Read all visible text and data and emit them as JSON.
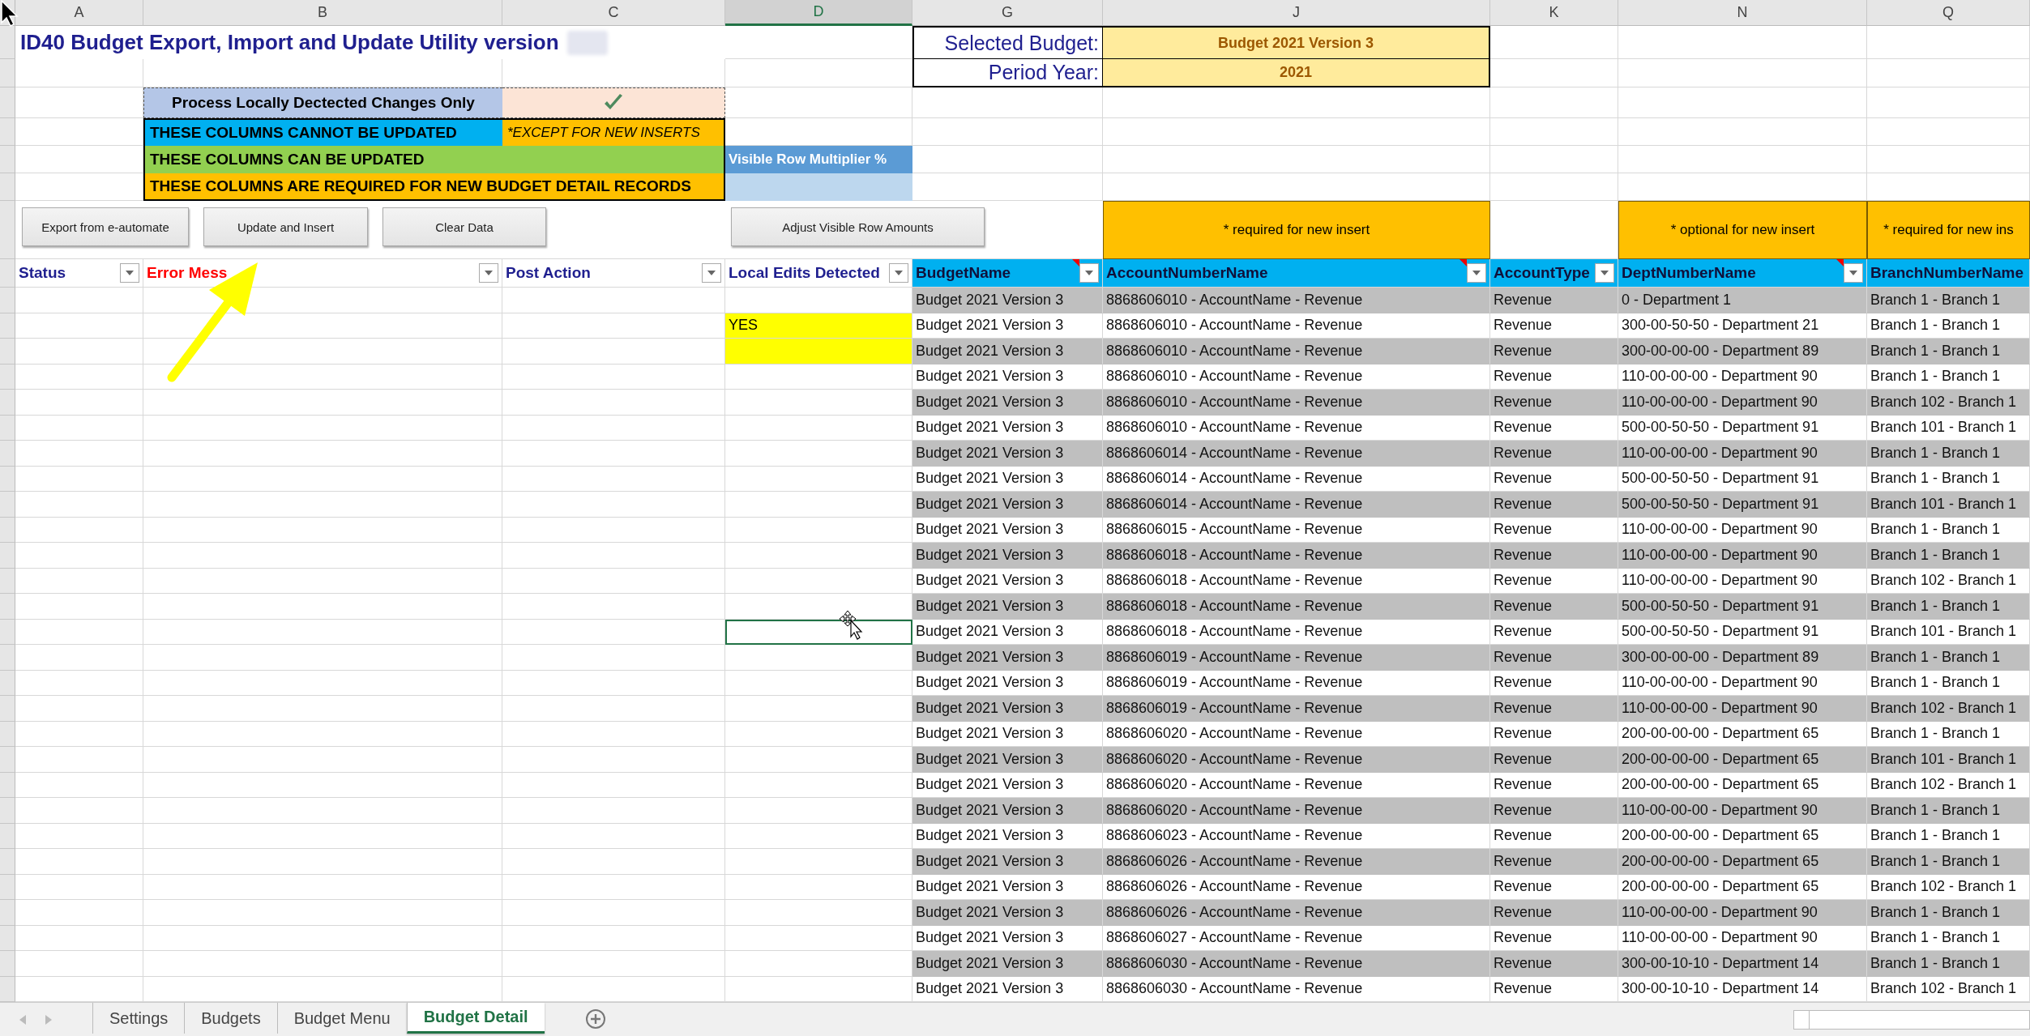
{
  "column_headers": [
    {
      "label": "A",
      "selected": false
    },
    {
      "label": "B",
      "selected": false
    },
    {
      "label": "C",
      "selected": false
    },
    {
      "label": "D",
      "selected": true
    },
    {
      "label": "G",
      "selected": false
    },
    {
      "label": "J",
      "selected": false
    },
    {
      "label": "K",
      "selected": false
    },
    {
      "label": "N",
      "selected": false
    },
    {
      "label": "Q",
      "selected": false
    }
  ],
  "title": "ID40 Budget Export, Import and Update Utility version",
  "selected_budget": {
    "label": "Selected Budget:",
    "value": "Budget 2021 Version 3"
  },
  "period_year": {
    "label": "Period Year:",
    "value": "2021"
  },
  "process_option": {
    "label": "Process Locally Dectected Changes Only",
    "checked": true
  },
  "legend": {
    "cannot_update": "THESE COLUMNS CANNOT BE UPDATED",
    "except_note": "*EXCEPT FOR NEW INSERTS",
    "can_update": "THESE COLUMNS CAN BE UPDATED",
    "required": "THESE COLUMNS ARE REQUIRED FOR NEW BUDGET DETAIL RECORDS"
  },
  "multiplier": {
    "label": "Visible Row Multiplier %"
  },
  "buttons": [
    "Export from e-automate",
    "Update and Insert",
    "Clear Data",
    "Adjust Visible Row Amounts"
  ],
  "column_notes": [
    "* required for new insert",
    "* optional for new insert",
    "* required for new ins"
  ],
  "status_columns": [
    {
      "label": "Status",
      "kind": "plain"
    },
    {
      "label": "Error Mess",
      "kind": "error"
    },
    {
      "label": "Post Action",
      "kind": "plain"
    },
    {
      "label": "Local Edits Detected",
      "kind": "plain"
    }
  ],
  "data_columns": [
    {
      "label": "BudgetName",
      "comment": true
    },
    {
      "label": "AccountNumberName",
      "comment": true
    },
    {
      "label": "AccountType",
      "comment": false
    },
    {
      "label": "DeptNumberName",
      "comment": true
    },
    {
      "label": "BranchNumberName",
      "comment": false
    }
  ],
  "rows": [
    {
      "cells": [
        "Budget 2021 Version 3",
        "8868606010 - AccountName - Revenue",
        "Revenue",
        "0 - Department 1",
        "Branch 1 - Branch 1"
      ],
      "highlighted": false,
      "selected": false
    },
    {
      "local_edits": "YES",
      "cells": [
        "Budget 2021 Version 3",
        "8868606010 - AccountName - Revenue",
        "Revenue",
        "300-00-50-50 - Department 21",
        "Branch 1 - Branch 1"
      ],
      "highlighted": true,
      "selected": false
    },
    {
      "cells": [
        "Budget 2021 Version 3",
        "8868606010 - AccountName - Revenue",
        "Revenue",
        "300-00-00-00 - Department 89",
        "Branch 1 - Branch 1"
      ],
      "highlighted": true,
      "selected": false
    },
    {
      "cells": [
        "Budget 2021 Version 3",
        "8868606010 - AccountName - Revenue",
        "Revenue",
        "110-00-00-00 - Department 90",
        "Branch 1 - Branch 1"
      ],
      "highlighted": false,
      "selected": false
    },
    {
      "cells": [
        "Budget 2021 Version 3",
        "8868606010 - AccountName - Revenue",
        "Revenue",
        "110-00-00-00 - Department 90",
        "Branch 102 - Branch 1"
      ],
      "highlighted": false,
      "selected": false
    },
    {
      "cells": [
        "Budget 2021 Version 3",
        "8868606010 - AccountName - Revenue",
        "Revenue",
        "500-00-50-50 - Department 91",
        "Branch 101 - Branch 1"
      ],
      "highlighted": false,
      "selected": false
    },
    {
      "cells": [
        "Budget 2021 Version 3",
        "8868606014 - AccountName - Revenue",
        "Revenue",
        "110-00-00-00 - Department 90",
        "Branch 1 - Branch 1"
      ],
      "highlighted": false,
      "selected": false
    },
    {
      "cells": [
        "Budget 2021 Version 3",
        "8868606014 - AccountName - Revenue",
        "Revenue",
        "500-00-50-50 - Department 91",
        "Branch 1 - Branch 1"
      ],
      "highlighted": false,
      "selected": false
    },
    {
      "cells": [
        "Budget 2021 Version 3",
        "8868606014 - AccountName - Revenue",
        "Revenue",
        "500-00-50-50 - Department 91",
        "Branch 101 - Branch 1"
      ],
      "highlighted": false,
      "selected": false
    },
    {
      "cells": [
        "Budget 2021 Version 3",
        "8868606015 - AccountName - Revenue",
        "Revenue",
        "110-00-00-00 - Department 90",
        "Branch 1 - Branch 1"
      ],
      "highlighted": false,
      "selected": false
    },
    {
      "cells": [
        "Budget 2021 Version 3",
        "8868606018 - AccountName - Revenue",
        "Revenue",
        "110-00-00-00 - Department 90",
        "Branch 1 - Branch 1"
      ],
      "highlighted": false,
      "selected": false
    },
    {
      "cells": [
        "Budget 2021 Version 3",
        "8868606018 - AccountName - Revenue",
        "Revenue",
        "110-00-00-00 - Department 90",
        "Branch 102 - Branch 1"
      ],
      "highlighted": false,
      "selected": false
    },
    {
      "cells": [
        "Budget 2021 Version 3",
        "8868606018 - AccountName - Revenue",
        "Revenue",
        "500-00-50-50 - Department 91",
        "Branch 1 - Branch 1"
      ],
      "highlighted": false,
      "selected": false
    },
    {
      "cells": [
        "Budget 2021 Version 3",
        "8868606018 - AccountName - Revenue",
        "Revenue",
        "500-00-50-50 - Department 91",
        "Branch 101 - Branch 1"
      ],
      "highlighted": false,
      "selected": true
    },
    {
      "cells": [
        "Budget 2021 Version 3",
        "8868606019 - AccountName - Revenue",
        "Revenue",
        "300-00-00-00 - Department 89",
        "Branch 1 - Branch 1"
      ],
      "highlighted": false,
      "selected": false
    },
    {
      "cells": [
        "Budget 2021 Version 3",
        "8868606019 - AccountName - Revenue",
        "Revenue",
        "110-00-00-00 - Department 90",
        "Branch 1 - Branch 1"
      ],
      "highlighted": false,
      "selected": false
    },
    {
      "cells": [
        "Budget 2021 Version 3",
        "8868606019 - AccountName - Revenue",
        "Revenue",
        "110-00-00-00 - Department 90",
        "Branch 102 - Branch 1"
      ],
      "highlighted": false,
      "selected": false
    },
    {
      "cells": [
        "Budget 2021 Version 3",
        "8868606020 - AccountName - Revenue",
        "Revenue",
        "200-00-00-00 - Department 65",
        "Branch 1 - Branch 1"
      ],
      "highlighted": false,
      "selected": false
    },
    {
      "cells": [
        "Budget 2021 Version 3",
        "8868606020 - AccountName - Revenue",
        "Revenue",
        "200-00-00-00 - Department 65",
        "Branch 101 - Branch 1"
      ],
      "highlighted": false,
      "selected": false
    },
    {
      "cells": [
        "Budget 2021 Version 3",
        "8868606020 - AccountName - Revenue",
        "Revenue",
        "200-00-00-00 - Department 65",
        "Branch 102 - Branch 1"
      ],
      "highlighted": false,
      "selected": false
    },
    {
      "cells": [
        "Budget 2021 Version 3",
        "8868606020 - AccountName - Revenue",
        "Revenue",
        "110-00-00-00 - Department 90",
        "Branch 1 - Branch 1"
      ],
      "highlighted": false,
      "selected": false
    },
    {
      "cells": [
        "Budget 2021 Version 3",
        "8868606023 - AccountName - Revenue",
        "Revenue",
        "200-00-00-00 - Department 65",
        "Branch 1 - Branch 1"
      ],
      "highlighted": false,
      "selected": false
    },
    {
      "cells": [
        "Budget 2021 Version 3",
        "8868606026 - AccountName - Revenue",
        "Revenue",
        "200-00-00-00 - Department 65",
        "Branch 1 - Branch 1"
      ],
      "highlighted": false,
      "selected": false
    },
    {
      "cells": [
        "Budget 2021 Version 3",
        "8868606026 - AccountName - Revenue",
        "Revenue",
        "200-00-00-00 - Department 65",
        "Branch 102 - Branch 1"
      ],
      "highlighted": false,
      "selected": false
    },
    {
      "cells": [
        "Budget 2021 Version 3",
        "8868606026 - AccountName - Revenue",
        "Revenue",
        "110-00-00-00 - Department 90",
        "Branch 1 - Branch 1"
      ],
      "highlighted": false,
      "selected": false
    },
    {
      "cells": [
        "Budget 2021 Version 3",
        "8868606027 - AccountName - Revenue",
        "Revenue",
        "110-00-00-00 - Department 90",
        "Branch 1 - Branch 1"
      ],
      "highlighted": false,
      "selected": false
    },
    {
      "cells": [
        "Budget 2021 Version 3",
        "8868606030 - AccountName - Revenue",
        "Revenue",
        "300-00-10-10 - Department 14",
        "Branch 1 - Branch 1"
      ],
      "highlighted": false,
      "selected": false
    },
    {
      "cells": [
        "Budget 2021 Version 3",
        "8868606030 - AccountName - Revenue",
        "Revenue",
        "300-00-10-10 - Department 14",
        "Branch 102 - Branch 1"
      ],
      "highlighted": false,
      "selected": false
    }
  ],
  "sheet_tabs": [
    {
      "label": "Settings",
      "selected": false
    },
    {
      "label": "Budgets",
      "selected": false
    },
    {
      "label": "Budget Menu",
      "selected": false
    },
    {
      "label": "Budget Detail",
      "selected": true
    }
  ]
}
